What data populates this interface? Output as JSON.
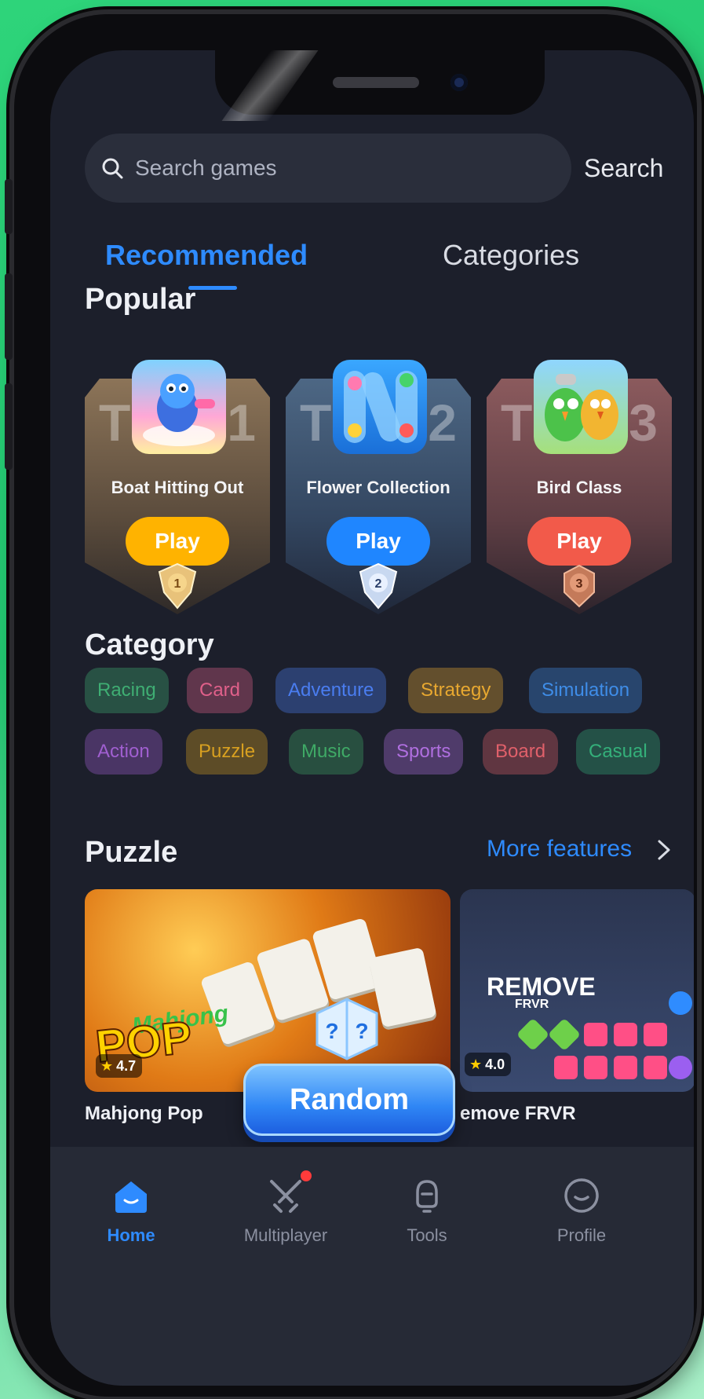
{
  "search": {
    "placeholder": "Search games",
    "button_label": "Search"
  },
  "tabs": [
    {
      "label": "Recommended",
      "active": true
    },
    {
      "label": "Categories",
      "active": false
    }
  ],
  "popular": {
    "title": "Popular",
    "cards": [
      {
        "rank": "1",
        "badge_letter": "T",
        "name": "Boat Hitting Out",
        "play_label": "Play",
        "accent": "#ffb300"
      },
      {
        "rank": "2",
        "badge_letter": "T",
        "name": "Flower Collection",
        "play_label": "Play",
        "accent": "#1f86ff"
      },
      {
        "rank": "3",
        "badge_letter": "T",
        "name": "Bird Class",
        "play_label": "Play",
        "accent": "#f25a4a"
      }
    ]
  },
  "category": {
    "title": "Category",
    "chips": [
      {
        "label": "Racing",
        "color": "#3fae73"
      },
      {
        "label": "Card",
        "color": "#e0608a"
      },
      {
        "label": "Adventure",
        "color": "#4a7df0"
      },
      {
        "label": "Strategy",
        "color": "#e8a830"
      },
      {
        "label": "Simulation",
        "color": "#3f8de8"
      },
      {
        "label": "Action",
        "color": "#a05fd0"
      },
      {
        "label": "Puzzle",
        "color": "#d8a020"
      },
      {
        "label": "Music",
        "color": "#3faa66"
      },
      {
        "label": "Sports",
        "color": "#b06fe0"
      },
      {
        "label": "Board",
        "color": "#e0606a"
      },
      {
        "label": "Casual",
        "color": "#34b07a"
      }
    ]
  },
  "puzzle": {
    "title": "Puzzle",
    "more_label": "More features",
    "games": [
      {
        "name": "Mahjong Pop",
        "rating": "4.7",
        "logo_text": "POP",
        "logo_script": "Mahjong"
      },
      {
        "name": "emove FRVR",
        "rating": "4.0",
        "logo_text": "REMOVE",
        "logo_sub": "FRVR"
      }
    ]
  },
  "random": {
    "label": "Random"
  },
  "nav": [
    {
      "label": "Home",
      "icon": "home-icon",
      "active": true
    },
    {
      "label": "Multiplayer",
      "icon": "swords-icon",
      "active": false,
      "has_notification": true
    },
    {
      "label": "Tools",
      "icon": "tools-icon",
      "active": false
    },
    {
      "label": "Profile",
      "icon": "profile-icon",
      "active": false
    }
  ],
  "colors": {
    "accent": "#2e8bff",
    "background": "#1c1f2b",
    "nav_bg": "#262a36"
  }
}
